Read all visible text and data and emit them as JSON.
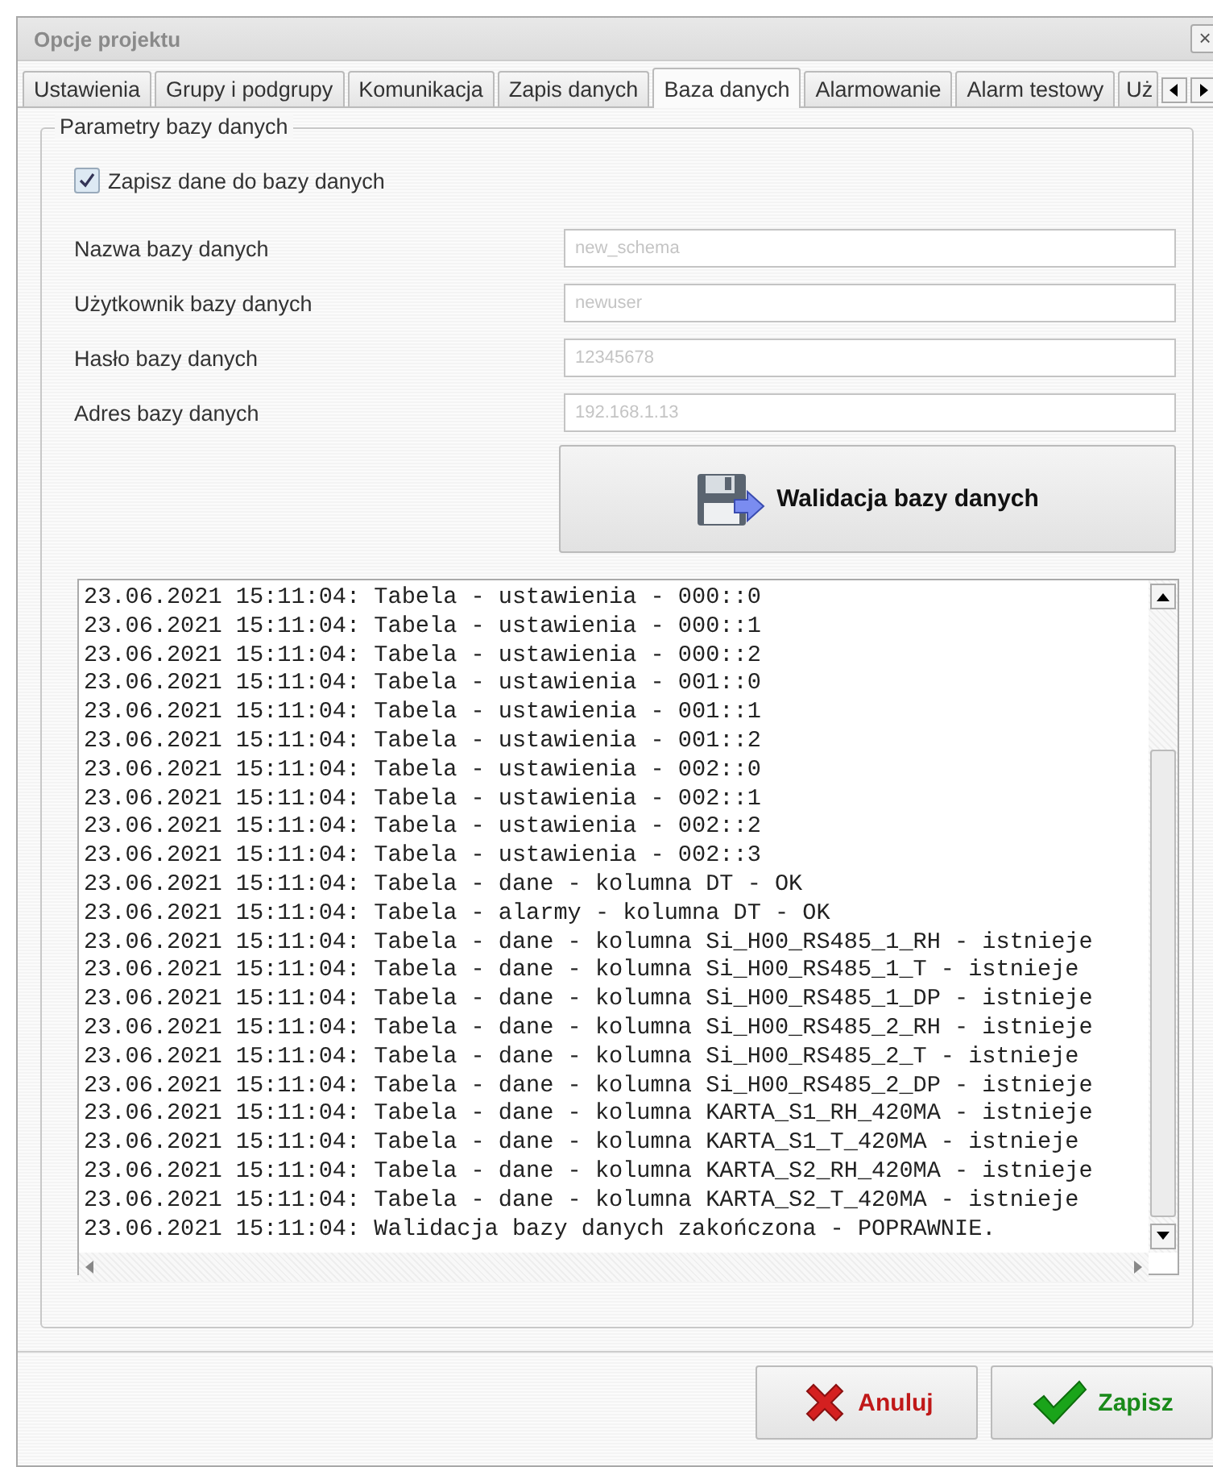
{
  "window": {
    "title": "Opcje projektu",
    "close": "×"
  },
  "tabs": [
    {
      "label": "Ustawienia",
      "selected": false
    },
    {
      "label": "Grupy i podgrupy",
      "selected": false
    },
    {
      "label": "Komunikacja",
      "selected": false
    },
    {
      "label": "Zapis danych",
      "selected": false
    },
    {
      "label": "Baza danych",
      "selected": true
    },
    {
      "label": "Alarmowanie",
      "selected": false
    },
    {
      "label": "Alarm testowy",
      "selected": false
    },
    {
      "label": "Uż",
      "selected": false
    }
  ],
  "group": {
    "title": "Parametry bazy danych",
    "checkbox": {
      "label": "Zapisz dane do bazy danych",
      "checked": true
    },
    "fields": [
      {
        "label": "Nazwa bazy danych",
        "value": "new_schema"
      },
      {
        "label": "Użytkownik bazy danych",
        "value": "newuser"
      },
      {
        "label": "Hasło bazy danych",
        "value": "12345678"
      },
      {
        "label": "Adres bazy danych",
        "value": "192.168.1.13"
      }
    ],
    "validate_button": "Walidacja bazy danych",
    "log": [
      "23.06.2021 15:11:04: Tabela - ustawienia - 000::0",
      "23.06.2021 15:11:04: Tabela - ustawienia - 000::1",
      "23.06.2021 15:11:04: Tabela - ustawienia - 000::2",
      "23.06.2021 15:11:04: Tabela - ustawienia - 001::0",
      "23.06.2021 15:11:04: Tabela - ustawienia - 001::1",
      "23.06.2021 15:11:04: Tabela - ustawienia - 001::2",
      "23.06.2021 15:11:04: Tabela - ustawienia - 002::0",
      "23.06.2021 15:11:04: Tabela - ustawienia - 002::1",
      "23.06.2021 15:11:04: Tabela - ustawienia - 002::2",
      "23.06.2021 15:11:04: Tabela - ustawienia - 002::3",
      "23.06.2021 15:11:04: Tabela - dane - kolumna DT - OK",
      "23.06.2021 15:11:04: Tabela - alarmy - kolumna DT - OK",
      "23.06.2021 15:11:04: Tabela - dane - kolumna Si_H00_RS485_1_RH - istnieje",
      "23.06.2021 15:11:04: Tabela - dane - kolumna Si_H00_RS485_1_T - istnieje",
      "23.06.2021 15:11:04: Tabela - dane - kolumna Si_H00_RS485_1_DP - istnieje",
      "23.06.2021 15:11:04: Tabela - dane - kolumna Si_H00_RS485_2_RH - istnieje",
      "23.06.2021 15:11:04: Tabela - dane - kolumna Si_H00_RS485_2_T - istnieje",
      "23.06.2021 15:11:04: Tabela - dane - kolumna Si_H00_RS485_2_DP - istnieje",
      "23.06.2021 15:11:04: Tabela - dane - kolumna KARTA_S1_RH_420MA - istnieje",
      "23.06.2021 15:11:04: Tabela - dane - kolumna KARTA_S1_T_420MA - istnieje",
      "23.06.2021 15:11:04: Tabela - dane - kolumna KARTA_S2_RH_420MA - istnieje",
      "23.06.2021 15:11:04: Tabela - dane - kolumna KARTA_S2_T_420MA - istnieje",
      "23.06.2021 15:11:04: Walidacja bazy danych zakończona - POPRAWNIE."
    ]
  },
  "buttons": [
    {
      "kind": "cancel",
      "label": "Anuluj"
    },
    {
      "kind": "save",
      "label": "Zapisz"
    }
  ]
}
